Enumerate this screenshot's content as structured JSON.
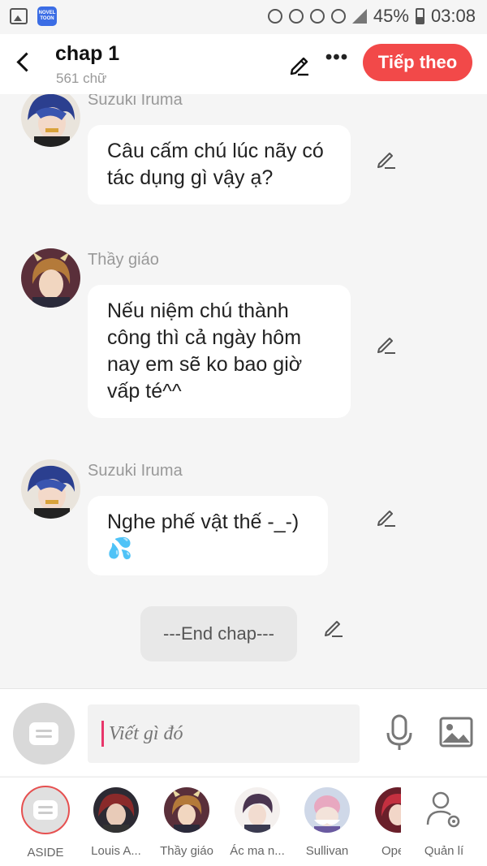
{
  "status_bar": {
    "app_badge": "NOVEL TOON",
    "battery": "45%",
    "time": "03:08"
  },
  "header": {
    "title": "chap 1",
    "word_count": "561 chữ",
    "next_label": "Tiếp theo"
  },
  "messages": [
    {
      "sender": "Suzuki Iruma",
      "text": "Câu cấm chú lúc nãy có tác dụng gì vậy ạ?",
      "avatar": "iruma"
    },
    {
      "sender": "Thầy giáo",
      "text": "Nếu niệm chú thành công thì cả ngày hôm nay em sẽ ko bao giờ vấp té^^",
      "avatar": "teacher"
    },
    {
      "sender": "Suzuki Iruma",
      "text": "Nghe phế vật thế -_-)💦",
      "avatar": "iruma"
    }
  ],
  "aside_message": {
    "text": "---End chap---"
  },
  "input": {
    "placeholder": "Viết gì đó"
  },
  "characters": [
    {
      "name": "ASIDE",
      "avatar": "aside"
    },
    {
      "name": "Louis A...",
      "avatar": "louis"
    },
    {
      "name": "Thầy giáo",
      "avatar": "teacher"
    },
    {
      "name": "Ác ma n...",
      "avatar": "acma"
    },
    {
      "name": "Sullivan",
      "avatar": "sullivan"
    },
    {
      "name": "Ope",
      "avatar": "ope"
    },
    {
      "name": "Quản lí",
      "avatar": "manage"
    }
  ],
  "colors": {
    "accent": "#f24949",
    "background": "#f5f5f5",
    "bubble": "#ffffff",
    "caret": "#e8366a"
  }
}
